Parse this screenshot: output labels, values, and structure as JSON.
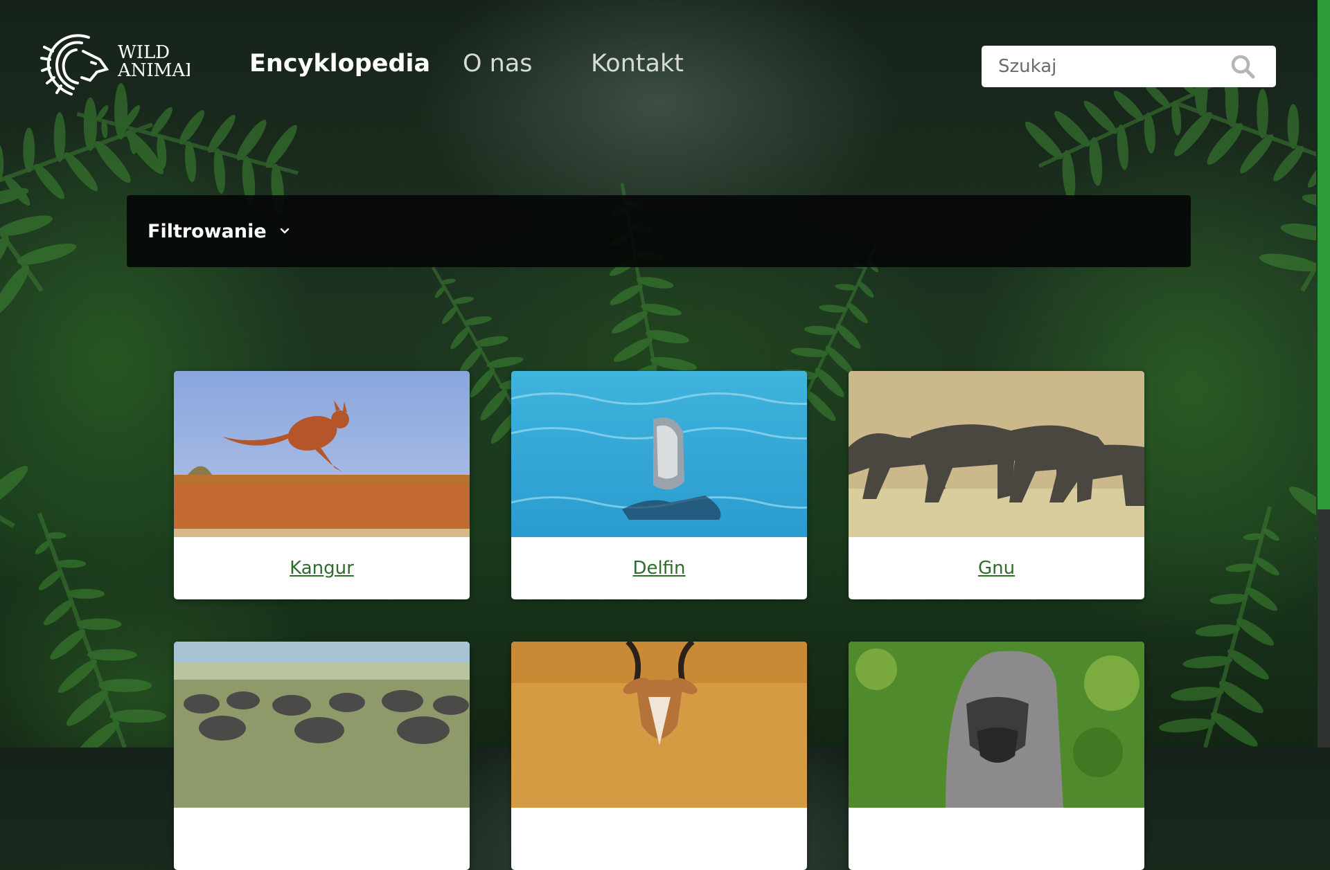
{
  "logo": {
    "text_line1": "WILD",
    "text_line2": "ANIMAI"
  },
  "nav": {
    "items": [
      {
        "label": "Encyklopedia",
        "active": true
      },
      {
        "label": "O nas",
        "active": false
      },
      {
        "label": "Kontakt",
        "active": false
      }
    ]
  },
  "search": {
    "placeholder": "Szukaj",
    "icon": "search-icon"
  },
  "filter": {
    "label": "Filtrowanie",
    "icon": "chevron-down-icon"
  },
  "cards": [
    {
      "name": "Kangur"
    },
    {
      "name": "Delfin"
    },
    {
      "name": "Gnu"
    },
    {
      "name": ""
    },
    {
      "name": ""
    },
    {
      "name": ""
    }
  ],
  "colors": {
    "accent": "#2e9c3a",
    "link": "#2c6d2c",
    "filter_bar": "#050806"
  }
}
